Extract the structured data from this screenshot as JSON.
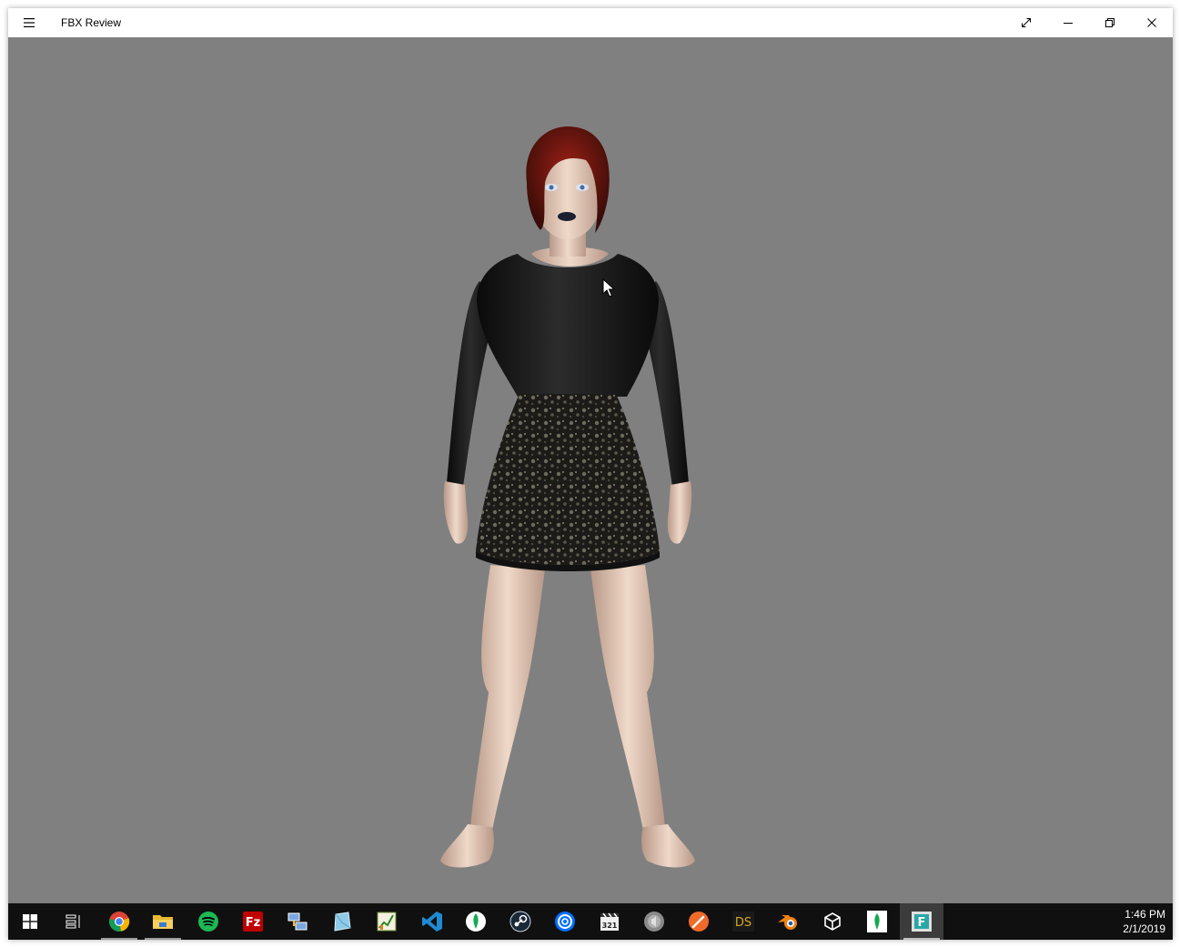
{
  "window": {
    "title": "FBX Review"
  },
  "titlebar_icons": {
    "menu": "hamburger-icon",
    "fullscreen": "expand-icon",
    "minimize": "minimize-icon",
    "restore": "restore-icon",
    "close": "close-icon"
  },
  "viewport": {
    "background": "#808080"
  },
  "taskbar": {
    "items": [
      {
        "name": "start-icon"
      },
      {
        "name": "task-view-icon"
      },
      {
        "name": "chrome-icon"
      },
      {
        "name": "file-explorer-icon"
      },
      {
        "name": "spotify-icon"
      },
      {
        "name": "filezilla-icon"
      },
      {
        "name": "network-tool-icon"
      },
      {
        "name": "sketch-tool-icon"
      },
      {
        "name": "chart-app-icon"
      },
      {
        "name": "vscode-icon"
      },
      {
        "name": "mongodb-icon"
      },
      {
        "name": "steam-icon"
      },
      {
        "name": "uplay-icon"
      },
      {
        "name": "calendar-clapper-icon"
      },
      {
        "name": "speaker-icon"
      },
      {
        "name": "brush-app-icon"
      },
      {
        "name": "daz-studio-icon",
        "label": "DS"
      },
      {
        "name": "blender-icon"
      },
      {
        "name": "unity-icon"
      },
      {
        "name": "mongodb-compass-icon"
      },
      {
        "name": "fbx-review-icon"
      }
    ],
    "clock": {
      "time": "1:46 PM",
      "date": "2/1/2019"
    }
  }
}
